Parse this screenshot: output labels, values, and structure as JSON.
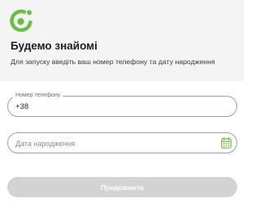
{
  "header": {
    "logo_icon": "bank-logo-icon",
    "title": "Будемо знайомі",
    "subtitle": "Для запуску введіть ваш номер телефону та дату народження"
  },
  "form": {
    "phone": {
      "label": "Номер телефону",
      "value": "+38"
    },
    "birth_date": {
      "placeholder": "Дата народження",
      "icon": "calendar-icon"
    },
    "submit_label": "Продовжити"
  },
  "colors": {
    "brand_green": "#6bbd45",
    "header_background": "#f4f4f4",
    "field_border": "#9e9e9e",
    "button_disabled": "#d3d3d3"
  }
}
